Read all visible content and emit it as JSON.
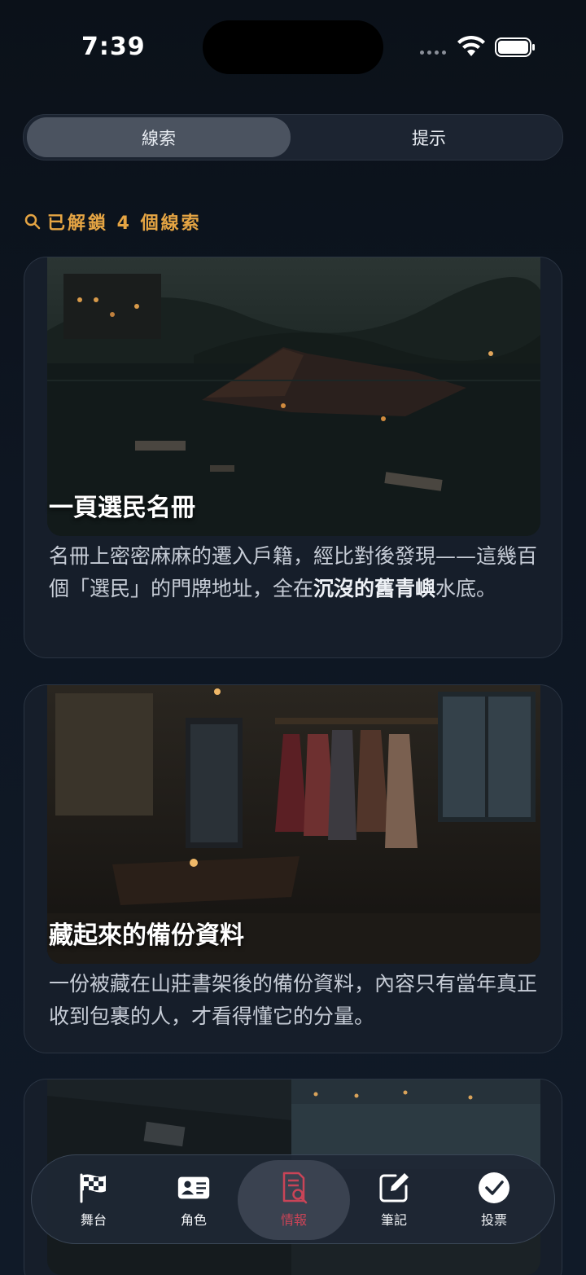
{
  "status_bar": {
    "time": "7:39"
  },
  "tabs": [
    {
      "label": "線索",
      "selected": true
    },
    {
      "label": "提示",
      "selected": false
    }
  ],
  "unlocked_text": "已解鎖 4 個線索",
  "clues": [
    {
      "title": "一頁選民名冊",
      "desc_pre": "名冊上密密麻麻的遷入戶籍，經比對後發現——這幾百個「選民」的門牌地址，全在",
      "desc_bold": "沉沒的舊青嶼",
      "desc_post": "水底。"
    },
    {
      "title": "藏起來的備份資料",
      "desc_pre": "一份被藏在山莊書架後的備份資料，內容只有當年真正收到包裹的人，才看得懂它的分量。",
      "desc_bold": "",
      "desc_post": ""
    },
    {
      "title": "",
      "desc_pre": "",
      "desc_bold": "",
      "desc_post": ""
    }
  ],
  "nav": [
    {
      "label": "舞台",
      "icon": "checkered-flag-icon"
    },
    {
      "label": "角色",
      "icon": "id-card-icon"
    },
    {
      "label": "情報",
      "icon": "document-search-icon",
      "active": true
    },
    {
      "label": "筆記",
      "icon": "edit-note-icon"
    },
    {
      "label": "投票",
      "icon": "check-circle-icon"
    }
  ],
  "colors": {
    "accent": "#e5a443",
    "active_nav": "#c94457"
  }
}
